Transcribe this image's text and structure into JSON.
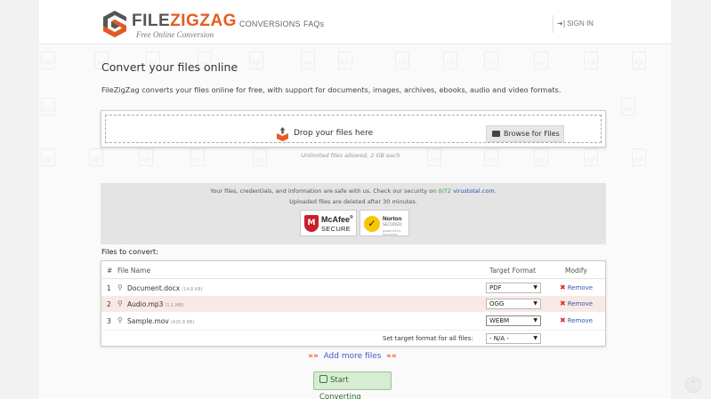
{
  "brand": {
    "name_left": "FILE",
    "name_right": "ZIGZAG",
    "tagline": "Free Online Conversion",
    "accent": "#e85b20"
  },
  "nav": {
    "conversions": "CONVERSIONS",
    "faqs": "FAQs",
    "signin": "SIGN IN"
  },
  "main": {
    "title": "Convert your files online",
    "intro": "FileZigZag converts your files online for free, with support for documents, images, archives, ebooks, audio and video formats."
  },
  "drop": {
    "text": "Drop your files here",
    "browse_label": "Browse for Files",
    "limit_note": "Unlimited files allowed, 2 GB each"
  },
  "security": {
    "line1_pre": "Your files, credentials, and information are safe with us. Check our security on ",
    "line1_score": "0/72",
    "line1_site": "virustotal.com",
    "line1_post": ".",
    "line2": "Uploaded files are deleted after 30 minutes.",
    "mcafee": {
      "name": "McAfee",
      "reg": "®",
      "sub": "SECURE"
    },
    "norton": {
      "name": "Norton",
      "sub": "SECURED",
      "powered": "powered by Symantec"
    }
  },
  "files_section": {
    "title": "Files to convert:",
    "columns": {
      "num": "#",
      "name": "File Name",
      "format": "Target Format",
      "modify": "Modify"
    },
    "rows": [
      {
        "num": "1",
        "name": "Document.docx",
        "size": "(14.8 KB)",
        "format": "PDF",
        "action": "Remove"
      },
      {
        "num": "2",
        "name": "Audio.mp3",
        "size": "(1.1 MB)",
        "format": "OGG",
        "action": "Remove"
      },
      {
        "num": "3",
        "name": "Sample.mov",
        "size": "(420.8 KB)",
        "format": "WEBM",
        "action": "Remove"
      }
    ],
    "all_label": "Set target format for all files:",
    "all_value": "- N/A -"
  },
  "actions": {
    "add_more": "Add more files",
    "start": "Start Converting"
  }
}
